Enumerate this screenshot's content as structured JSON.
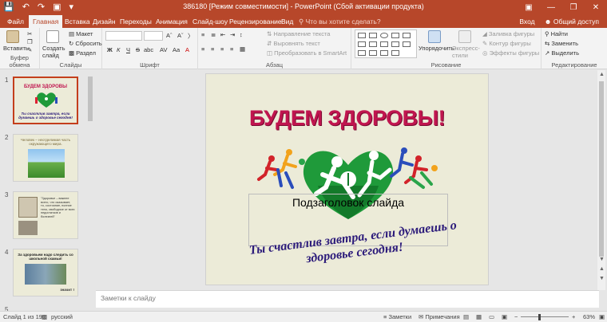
{
  "window": {
    "title": "386180 [Режим совместимости] - PowerPoint (Сбой активации продукта)"
  },
  "tabs": [
    {
      "label": "Файл"
    },
    {
      "label": "Главная"
    },
    {
      "label": "Вставка"
    },
    {
      "label": "Дизайн"
    },
    {
      "label": "Переходы"
    },
    {
      "label": "Анимация"
    },
    {
      "label": "Слайд-шоу"
    },
    {
      "label": "Рецензирование"
    },
    {
      "label": "Вид"
    }
  ],
  "tellme": "Что вы хотите сделать?",
  "account": {
    "signin": "Вход",
    "share": "Общий доступ"
  },
  "ribbon": {
    "clipboard": {
      "label": "Буфер обмена",
      "paste": "Вставить"
    },
    "slides": {
      "label": "Слайды",
      "new_slide": "Создать слайд",
      "layout": "Макет",
      "reset": "Сбросить",
      "section": "Раздел"
    },
    "font": {
      "label": "Шрифт",
      "bold": "Ж",
      "italic": "К",
      "underline": "Ч",
      "strike": "S",
      "shadow": "abc"
    },
    "paragraph": {
      "label": "Абзац",
      "text_direction": "Направление текста",
      "align_text": "Выровнять текст",
      "smartart": "Преобразовать в SmartArt"
    },
    "drawing": {
      "label": "Рисование",
      "arrange": "Упорядочить",
      "quick_styles": "Экспресс-стили",
      "fill": "Заливка фигуры",
      "outline": "Контур фигуры",
      "effects": "Эффекты фигуры"
    },
    "editing": {
      "label": "Редактирование",
      "find": "Найти",
      "replace": "Заменить",
      "select": "Выделить"
    }
  },
  "thumbnails": [
    {
      "num": "1",
      "title": "БУДЕМ ЗДОРОВЫ",
      "text": "Ты счастлив завтра, если думаешь о здоровье сегодня!"
    },
    {
      "num": "2",
      "title": "Человек – неотделимая часть окружающего мира."
    },
    {
      "num": "3",
      "text": "\"Здоровье – важнее всего, что оказывает, то, состояние, полное тело, свободное от всех недостатков и болезней\""
    },
    {
      "num": "4",
      "title": "За здоровьем надо следить со школьной скамьи!",
      "footer": "значит !"
    },
    {
      "num": "5"
    }
  ],
  "slide": {
    "title": "БУДЕМ ЗДОРОВЫ!",
    "subtitle_placeholder": "Подзаголовок слайда",
    "slogan": "Ты счастлив завтра, если думаешь о здоровье сегодня!"
  },
  "notes_placeholder": "Заметки к слайду",
  "status": {
    "slide_counter": "Слайд 1 из 19",
    "language": "русский",
    "notes_btn": "Заметки",
    "comments_btn": "Примечания",
    "zoom": "63%"
  },
  "colors": {
    "accent": "#b7472a",
    "slide_title": "#c0154f",
    "slogan": "#2b1a7a",
    "heart": "#1f9a3a"
  }
}
